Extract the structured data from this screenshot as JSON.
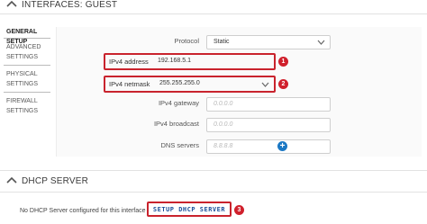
{
  "interfaces_section": {
    "title": "INTERFACES: GUEST"
  },
  "tabs": [
    {
      "label": "GENERAL SETUP"
    },
    {
      "label": "ADVANCED SETTINGS"
    },
    {
      "label": "PHYSICAL SETTINGS"
    },
    {
      "label": "FIREWALL SETTINGS"
    }
  ],
  "form": {
    "protocol": {
      "label": "Protocol",
      "value": "Static"
    },
    "ipv4_address": {
      "label": "IPv4 address",
      "value": "192.168.5.1",
      "badge": "1"
    },
    "ipv4_netmask": {
      "label": "IPv4 netmask",
      "value": "255.255.255.0",
      "badge": "2"
    },
    "ipv4_gateway": {
      "label": "IPv4 gateway",
      "placeholder": "0.0.0.0"
    },
    "ipv4_broadcast": {
      "label": "IPv4 broadcast",
      "placeholder": "0.0.0.0"
    },
    "dns_servers": {
      "label": "DNS servers",
      "placeholder": "8.8.8.8",
      "add_symbol": "+"
    }
  },
  "dhcp_section": {
    "title": "DHCP SERVER",
    "message": "No DHCP Server configured for this interface",
    "setup_button": "SETUP DHCP SERVER",
    "badge": "3"
  },
  "colors": {
    "highlight": "#c9232d",
    "badge": "#d0202c",
    "accent_blue": "#1b78c4"
  }
}
